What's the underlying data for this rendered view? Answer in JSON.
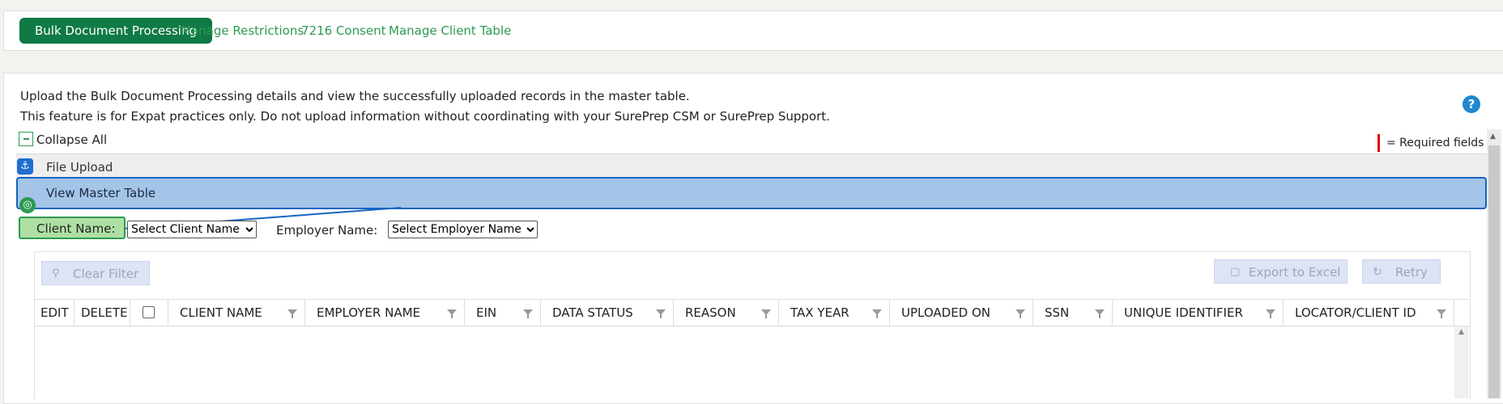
{
  "tabs": [
    {
      "label": "Bulk Document Processing",
      "active": true
    },
    {
      "label": "Manage Restrictions",
      "active": false
    },
    {
      "label": "7216 Consent",
      "active": false
    },
    {
      "label": "Manage Client Table",
      "active": false
    }
  ],
  "intro": {
    "line1": "Upload the Bulk Document Processing details and view the successfully uploaded records in the master table.",
    "line2": "This feature is for Expat practices only. Do not upload information without coordinating with your SurePrep CSM or SurePrep Support."
  },
  "help_label": "?",
  "collapse_all": "Collapse All",
  "required_note": "= Required fields",
  "sections": {
    "file_upload": "File Upload",
    "view_master": "View Master Table"
  },
  "filters": {
    "client_label": "Client Name:",
    "client_selected": "Select Client Name",
    "employer_label": "Employer Name:",
    "employer_selected": "Select Employer Name"
  },
  "toolbar": {
    "clear_filter": "Clear Filter",
    "export": "Export to Excel",
    "retry": "Retry"
  },
  "columns": [
    "EDIT",
    "DELETE",
    "",
    "CLIENT NAME",
    "EMPLOYER NAME",
    "EIN",
    "DATA STATUS",
    "REASON",
    "TAX YEAR",
    "UPLOADED ON",
    "SSN",
    "UNIQUE IDENTIFIER",
    "LOCATOR/CLIENT ID"
  ],
  "colors": {
    "brand": "#0f7a46",
    "link": "#2e9a52",
    "highlight": "#a4c4e8",
    "required": "#e00000"
  }
}
